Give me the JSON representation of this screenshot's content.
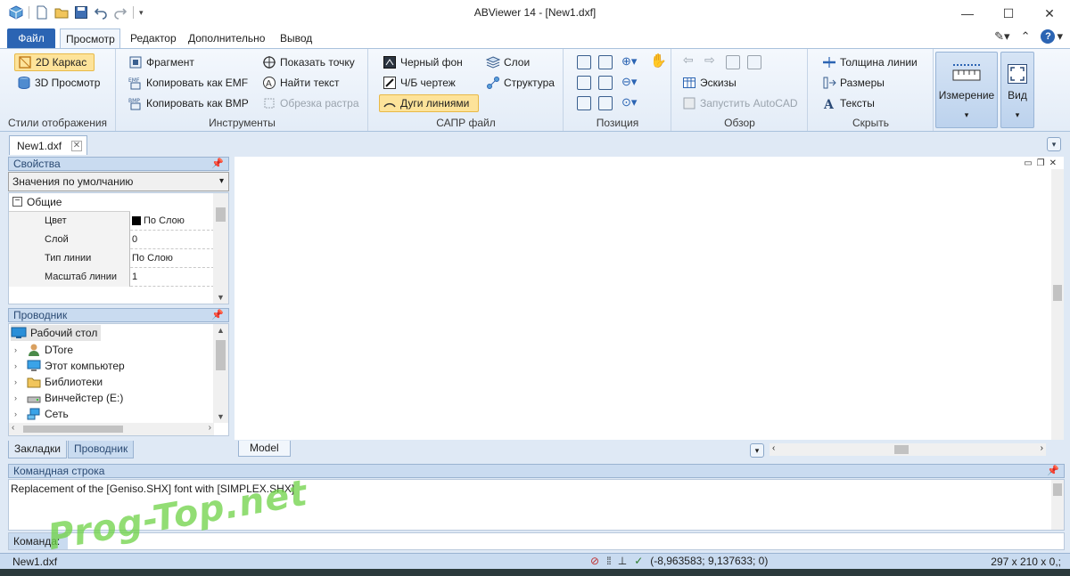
{
  "window": {
    "title": "ABViewer 14 - [New1.dxf]",
    "minimize": "—",
    "maximize": "☐",
    "close": "✕"
  },
  "ribbon_tabs": [
    "Файл",
    "Просмотр",
    "Редактор",
    "Дополнительно",
    "Вывод"
  ],
  "groups": {
    "display": {
      "label": "Стили отображения",
      "wireframe2d": "2D Каркас",
      "view3d": "3D Просмотр"
    },
    "tools": {
      "label": "Инструменты",
      "fragment": "Фрагмент",
      "copy_emf": "Копировать как EMF",
      "copy_bmp": "Копировать как BMP",
      "show_point": "Показать точку",
      "find_text": "Найти текст",
      "crop_raster": "Обрезка растра"
    },
    "cad": {
      "label": "САПР файл",
      "black_bg": "Черный фон",
      "bw_drawing": "Ч/Б чертеж",
      "arcs_lines": "Дуги линиями",
      "layers": "Слои",
      "structure": "Структура"
    },
    "position": {
      "label": "Позиция"
    },
    "review": {
      "label": "Обзор",
      "sketches": "Эскизы",
      "autocad": "Запустить AutoCAD"
    },
    "hide": {
      "label": "Скрыть",
      "line_width": "Толщина линии",
      "dimensions": "Размеры",
      "texts": "Тексты"
    },
    "measure": "Измерение",
    "view": "Вид"
  },
  "document_tab": "New1.dxf",
  "properties": {
    "title": "Свойства",
    "combo": "Значения по умолчанию",
    "section": "Общие",
    "rows": [
      {
        "key": "Цвет",
        "value": "По Слою"
      },
      {
        "key": "Слой",
        "value": "0"
      },
      {
        "key": "Тип линии",
        "value": "По Слою"
      },
      {
        "key": "Масштаб линии",
        "value": "1"
      }
    ]
  },
  "explorer": {
    "title": "Проводник",
    "root": "Рабочий стол",
    "items": [
      "DTore",
      "Этот компьютер",
      "Библиотеки",
      "Винчейстер (E:)",
      "Сеть"
    ]
  },
  "bottom_tabs": [
    "Закладки",
    "Проводник"
  ],
  "model_tab": "Model",
  "command": {
    "title": "Командная строка",
    "log": "Replacement of the [Geniso.SHX] font with [SIMPLEX.SHX]",
    "prompt": "Команда:"
  },
  "status": {
    "file": "New1.dxf",
    "coords": "(-8,963583; 9,137633; 0)",
    "size": "297 x 210 x 0,;"
  },
  "watermark": "Prog-Top.net",
  "colors": {
    "accent": "#2b64b3",
    "selected": "#fde39a",
    "panel_header": "#c9dbf0"
  }
}
